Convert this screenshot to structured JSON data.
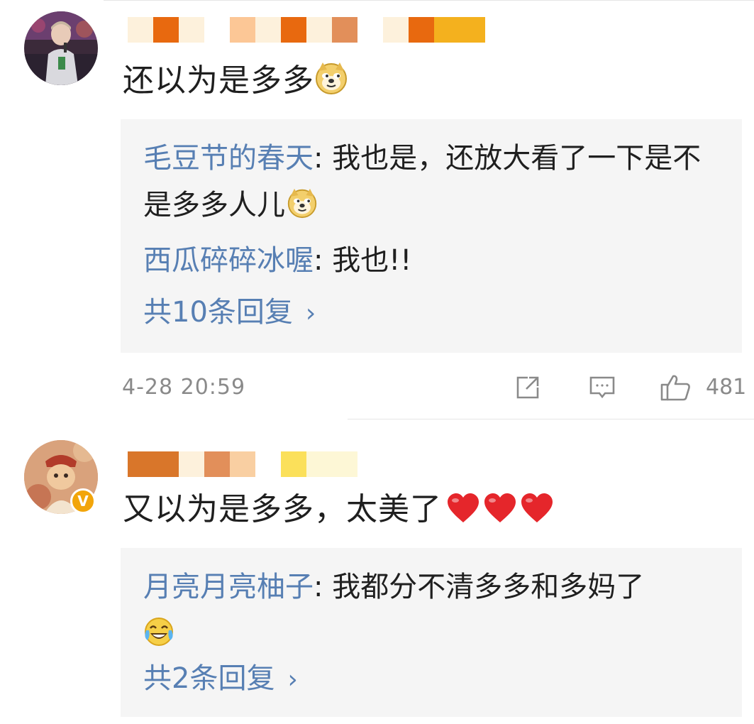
{
  "comments": [
    {
      "text": "还以为是多多",
      "replies": [
        {
          "nick": "毛豆节的春天",
          "sep": ": ",
          "body": "我也是，还放大看了一下是不是多多人儿"
        },
        {
          "nick": "西瓜碎碎冰喔",
          "sep": ": ",
          "body": "我也!!"
        }
      ],
      "more_label": "共10条回复",
      "time": "4-28 20:59",
      "like_count": "481"
    },
    {
      "text": "又以为是多多，太美了",
      "replies": [
        {
          "nick": "月亮月亮柚子",
          "sep": ": ",
          "body": "我都分不清多多和多妈了"
        }
      ],
      "more_label": "共2条回复"
    }
  ],
  "icons": {
    "share": "share-icon",
    "comment": "comment-icon",
    "like": "thumbs-up-icon",
    "doge": "doge-emoji",
    "heart": "heart-emoji",
    "laugh_cry": "laugh-cry-emoji",
    "verified": "verified-v-badge"
  },
  "colors": {
    "nick_blue": "#577fb3",
    "reply_bg": "#f5f5f5",
    "meta_gray": "#8a8a8a",
    "heart_red": "#e5262b",
    "badge_orange": "#f2a50a"
  }
}
